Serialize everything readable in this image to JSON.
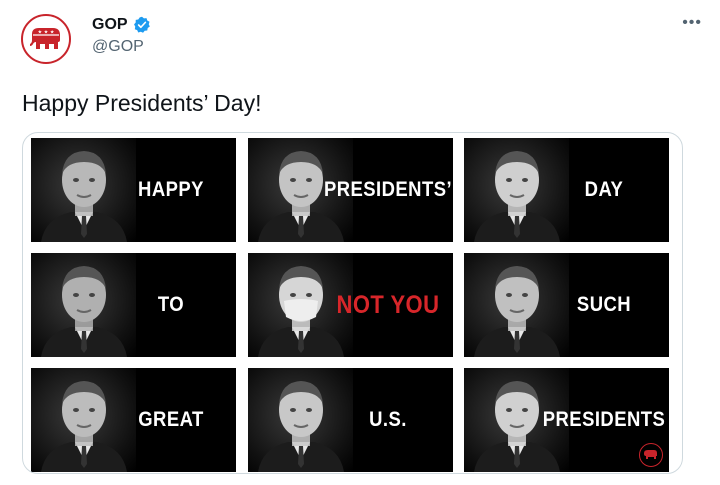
{
  "account": {
    "name": "GOP",
    "handle": "@GOP",
    "more_icon": "more-horizontal-icon",
    "verified_color": "#1d9bf0",
    "brand_color": "#c8242b"
  },
  "tweet": {
    "text": "Happy Presidents’ Day!"
  },
  "tiles": [
    {
      "word": "HAPPY"
    },
    {
      "word": "PRESIDENTS’"
    },
    {
      "word": "DAY"
    },
    {
      "word": "TO"
    },
    {
      "word": "NOT YOU",
      "accent": "#d8262a"
    },
    {
      "word": "SUCH"
    },
    {
      "word": "GREAT"
    },
    {
      "word": "U.S."
    },
    {
      "word": "PRESIDENTS"
    }
  ]
}
